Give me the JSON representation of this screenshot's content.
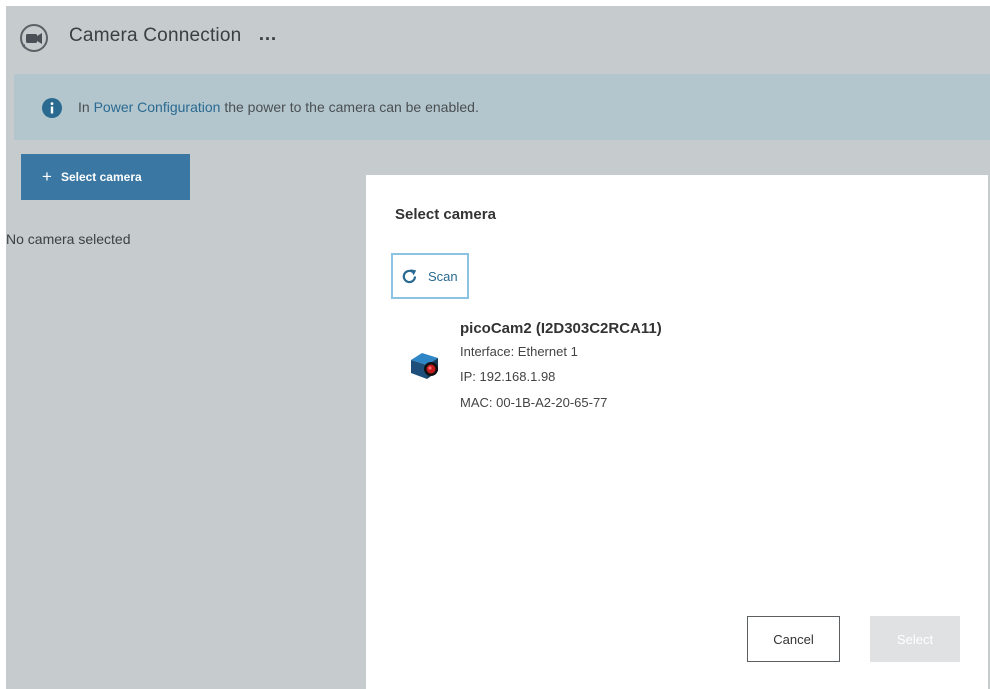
{
  "header": {
    "title": "Camera Connection",
    "more_label": "…",
    "app_icon": "camera-connection-icon"
  },
  "info": {
    "icon": "info-icon",
    "prefix": "In ",
    "link_text": "Power Configuration",
    "suffix": " the power to the camera can be enabled."
  },
  "toolbar": {
    "select_camera_label": "Select camera"
  },
  "status": {
    "no_camera": "No camera selected"
  },
  "modal": {
    "title": "Select camera",
    "scan_label": "Scan",
    "camera": {
      "name": "picoCam2 (I2D303C2RCA11)",
      "interface": "Interface: Ethernet 1",
      "ip": "IP: 192.168.1.98",
      "mac": "MAC: 00-1B-A2-20-65-77",
      "icon": "camera-device-icon"
    },
    "cancel_label": "Cancel",
    "select_label": "Select"
  },
  "colors": {
    "overlay": "#c6cbcd",
    "info_bar": "#b3c6ce",
    "primary_button": "#3a78a3",
    "link": "#2a6a91",
    "focus_outline": "#8bc3e3",
    "disabled_button": "#dfe1e2"
  }
}
